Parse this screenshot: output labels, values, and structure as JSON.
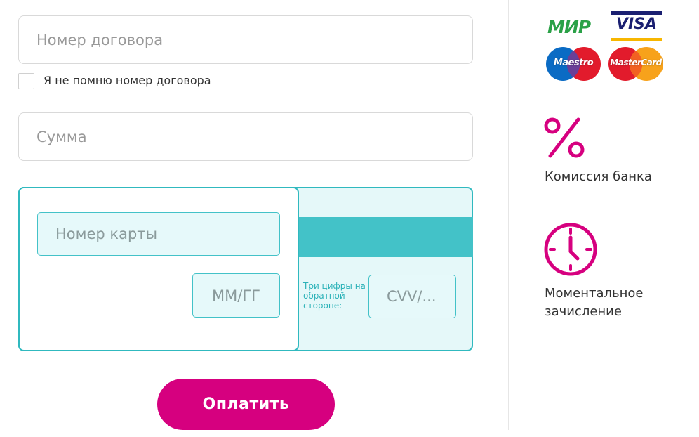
{
  "form": {
    "contract_placeholder": "Номер договора",
    "forgot_label": "Я не помню номер договора",
    "forgot_checked": false,
    "amount_placeholder": "Сумма"
  },
  "card": {
    "number_placeholder": "Номер карты",
    "expiry_placeholder": "ММ/ГГ",
    "cvv_hint": "Три цифры на обратной стороне:",
    "cvv_placeholder": "CVV/..."
  },
  "pay_button": {
    "label": "Оплатить"
  },
  "payment_systems": {
    "mir": "МИР",
    "visa": "VISA",
    "maestro": "Maestro",
    "mastercard": "MasterCard"
  },
  "features": {
    "commission_icon": "percent-icon",
    "commission_label": "Комиссия банка",
    "instant_icon": "clock-icon",
    "instant_label_line1": "Моментальное",
    "instant_label_line2": "зачисление"
  },
  "colors": {
    "accent": "#d6007f",
    "teal": "#30b9bf",
    "teal_light": "#e5f8f9"
  }
}
